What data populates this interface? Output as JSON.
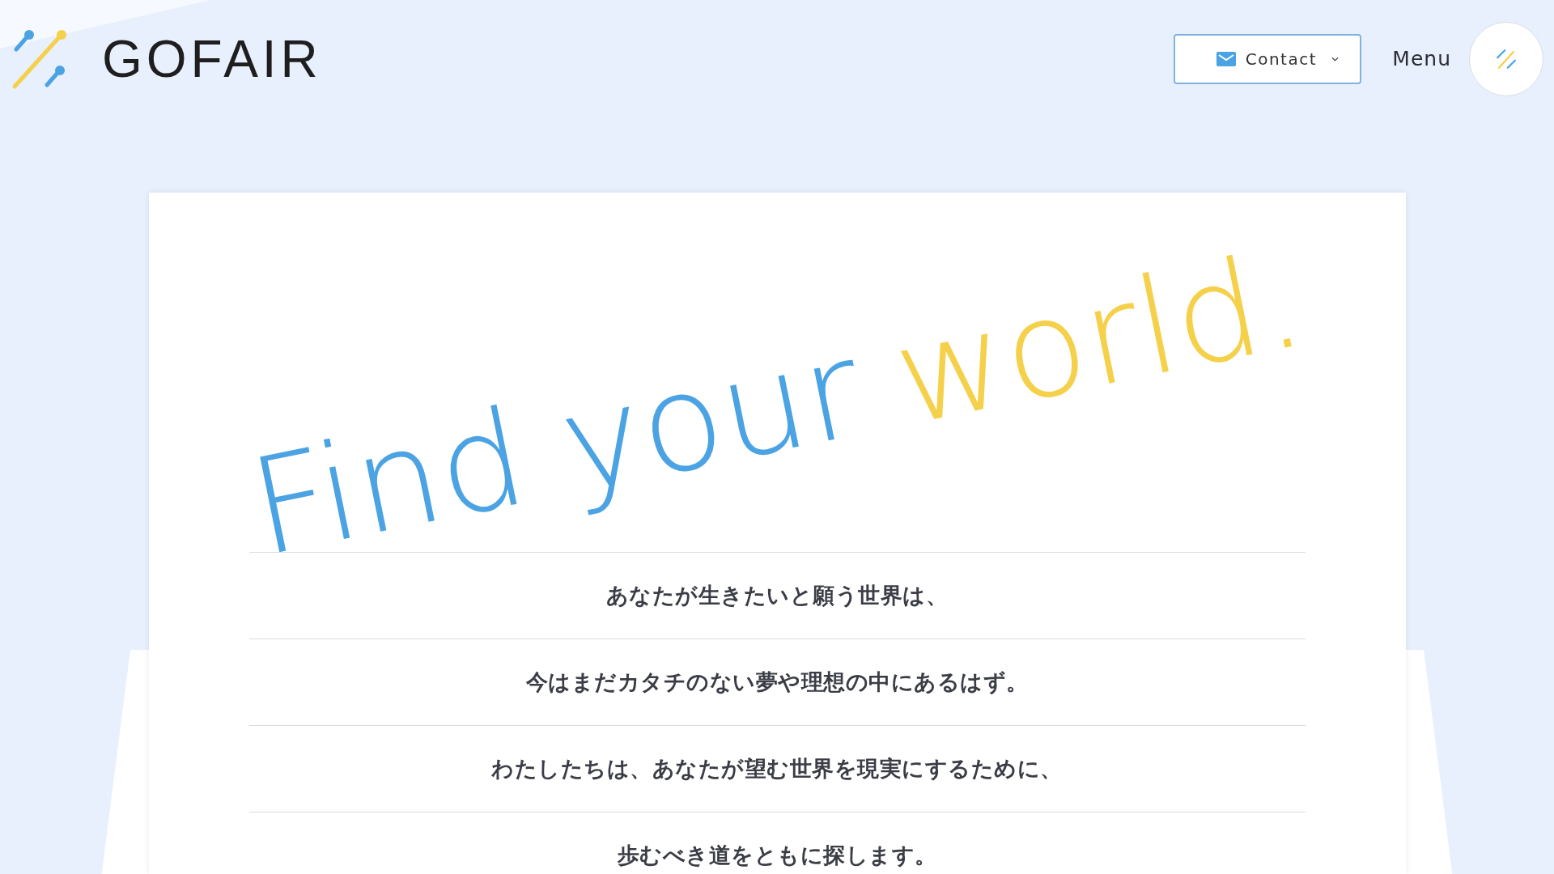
{
  "header": {
    "logo": {
      "text": "GOFAIR"
    },
    "contact_button": {
      "label": "Contact"
    },
    "menu": {
      "label": "Menu"
    }
  },
  "hero": {
    "headline": [
      {
        "text": "Find your",
        "color": "#4ba3e3"
      },
      {
        "text": "world.",
        "color": "#f5d04a"
      }
    ],
    "lines": [
      "あなたが生きたいと願う世界は、",
      "今はまだカタチのない夢や理想の中にあるはず。",
      "わたしたちは、あなたが望む世界を現実にするために、",
      "歩むべき道をともに探します。"
    ]
  }
}
